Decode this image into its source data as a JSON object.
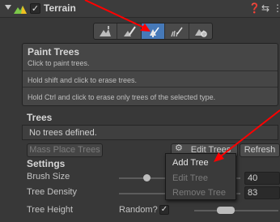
{
  "header": {
    "title": "Terrain",
    "enabled": true,
    "icons": [
      "terrain-icon",
      "help-icon",
      "preset-icon",
      "more-icon"
    ]
  },
  "toolbar": {
    "tools": [
      "raise-lower-terrain-tool",
      "paint-texture-tool",
      "paint-trees-tool",
      "paint-details-tool",
      "terrain-settings-tool"
    ],
    "active_index": 2
  },
  "help": {
    "title": "Paint Trees",
    "lines": [
      "Click to paint trees.",
      "Hold shift and click to erase trees.",
      "Hold Ctrl and click to erase only trees of the selected type."
    ]
  },
  "trees": {
    "section_title": "Trees",
    "empty_text": "No trees defined.",
    "mass_place_label": "Mass Place Trees",
    "edit_trees_label": "Edit Trees",
    "refresh_label": "Refresh"
  },
  "settings": {
    "section_title": "Settings",
    "brush_size_label": "Brush Size",
    "brush_size_value": "40",
    "tree_density_label": "Tree Density",
    "tree_density_value": "83",
    "tree_height_label": "Tree Height",
    "random_label": "Random?",
    "random_checked": true
  },
  "dropdown": {
    "items": [
      {
        "label": "Add Tree",
        "enabled": true
      },
      {
        "label": "Edit Tree",
        "enabled": false
      },
      {
        "label": "Remove Tree",
        "enabled": false
      }
    ]
  },
  "colors": {
    "active_tool": "#4679b8",
    "annotation_arrow": "#ff0000",
    "panel_bg": "#383838"
  }
}
